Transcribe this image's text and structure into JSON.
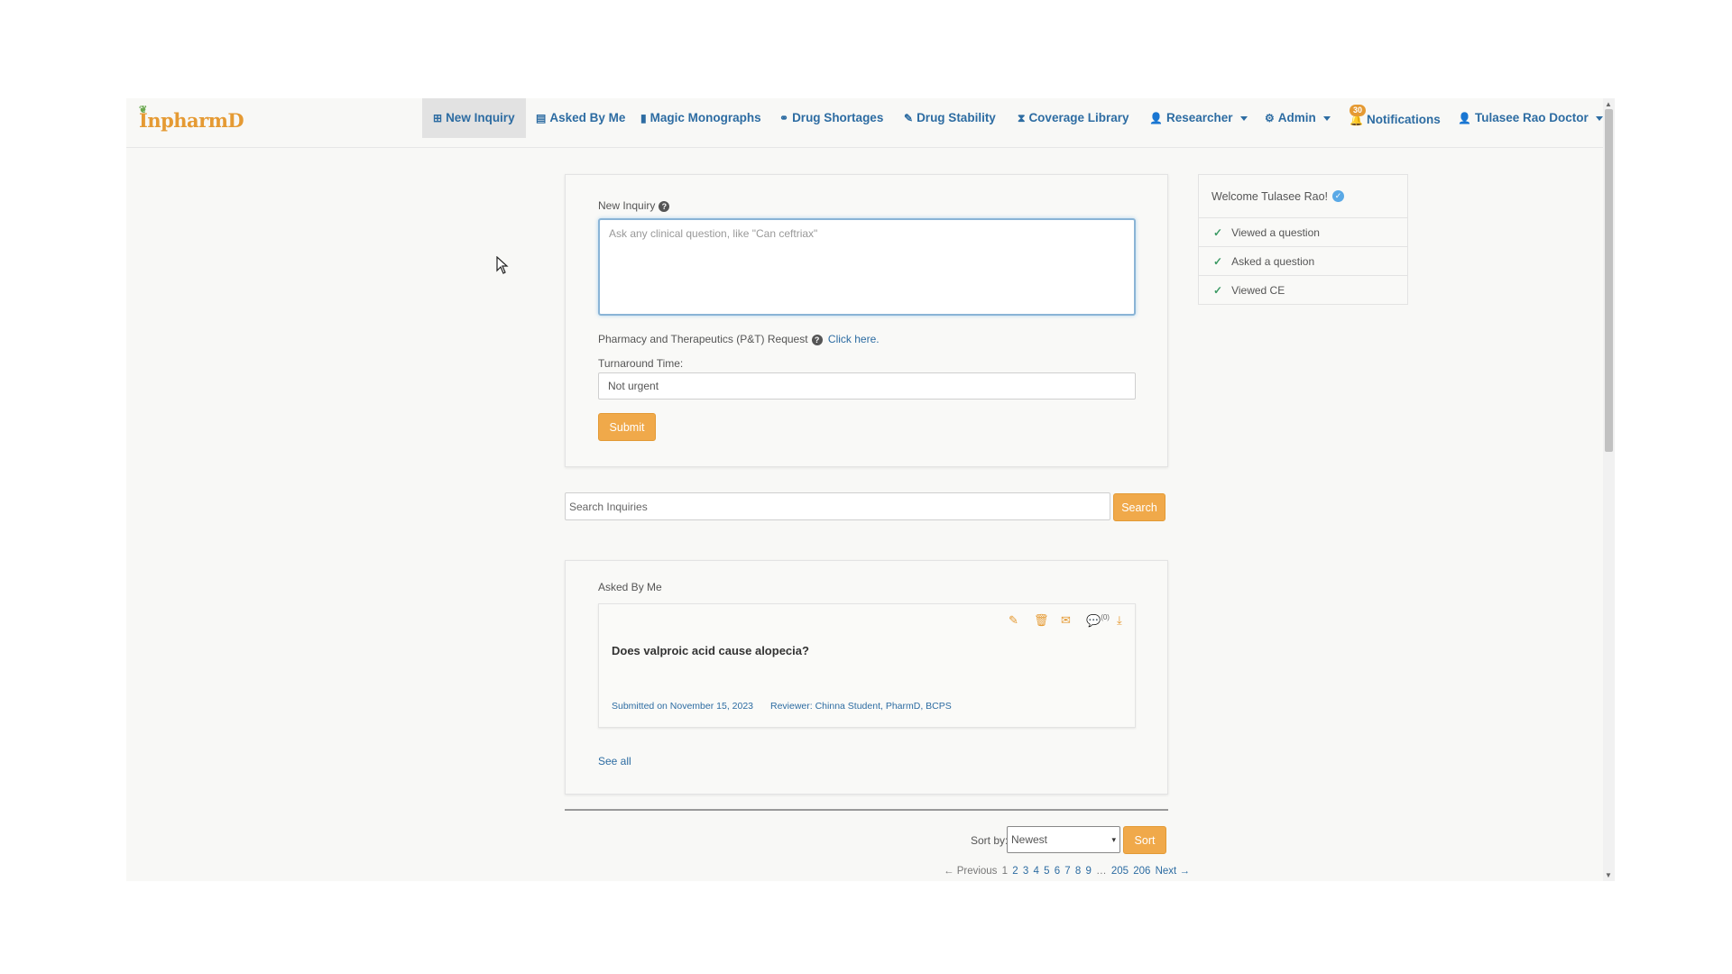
{
  "nav": {
    "logo": "InpharmD",
    "items": [
      {
        "label": "New Inquiry",
        "icon": "plus-square-icon",
        "glyph": "⊞"
      },
      {
        "label": "Asked By Me",
        "icon": "id-card-icon",
        "glyph": "▤"
      },
      {
        "label": "Magic Monographs",
        "icon": "document-icon",
        "glyph": "▮"
      },
      {
        "label": "Drug Shortages",
        "icon": "binoculars-icon",
        "glyph": "⚭"
      },
      {
        "label": "Drug Stability",
        "icon": "pencil-icon",
        "glyph": "✎"
      },
      {
        "label": "Coverage Library",
        "icon": "hourglass-icon",
        "glyph": "⧗"
      },
      {
        "label": "Researcher",
        "icon": "user-edit-icon",
        "glyph": "👤"
      },
      {
        "label": "Admin",
        "icon": "gear-icon",
        "glyph": "⚙"
      },
      {
        "label": "Notifications",
        "icon": "bell-icon",
        "glyph": "🔔",
        "badge": "30"
      },
      {
        "label": "Tulasee Rao Doctor",
        "icon": "user-icon",
        "glyph": "👤"
      }
    ]
  },
  "inquiry": {
    "label": "New Inquiry",
    "placeholder": "Ask any clinical question, like \"Can ceftriax\"",
    "pt_request_text": "Pharmacy and Therapeutics (P&T) Request",
    "pt_link": "Click here.",
    "turnaround_label": "Turnaround Time:",
    "turnaround_value": "Not urgent",
    "submit_label": "Submit"
  },
  "search": {
    "placeholder": "Search Inquiries",
    "button_label": "Search"
  },
  "asked_by_me": {
    "title": "Asked By Me",
    "question": "Does valproic acid cause alopecia?",
    "submitted": "Submitted on November 15, 2023",
    "reviewer": "Reviewer: Chinna Student, PharmD, BCPS",
    "comment_count": "(0)",
    "see_all": "See all"
  },
  "sort": {
    "label": "Sort by:",
    "selected": "Newest",
    "button_label": "Sort"
  },
  "pagination": {
    "previous": "← Previous",
    "current": "1",
    "pages": [
      "2",
      "3",
      "4",
      "5",
      "6",
      "7",
      "8",
      "9"
    ],
    "ellipsis": "…",
    "last_pages": [
      "205",
      "206"
    ],
    "next": "Next →"
  },
  "welcome": {
    "title": "Welcome Tulasee Rao!",
    "items": [
      "Viewed a question",
      "Asked a question",
      "Viewed CE"
    ]
  },
  "colors": {
    "accent": "#f0a94a",
    "link": "#2d6ca2",
    "check": "#3c9a64"
  }
}
